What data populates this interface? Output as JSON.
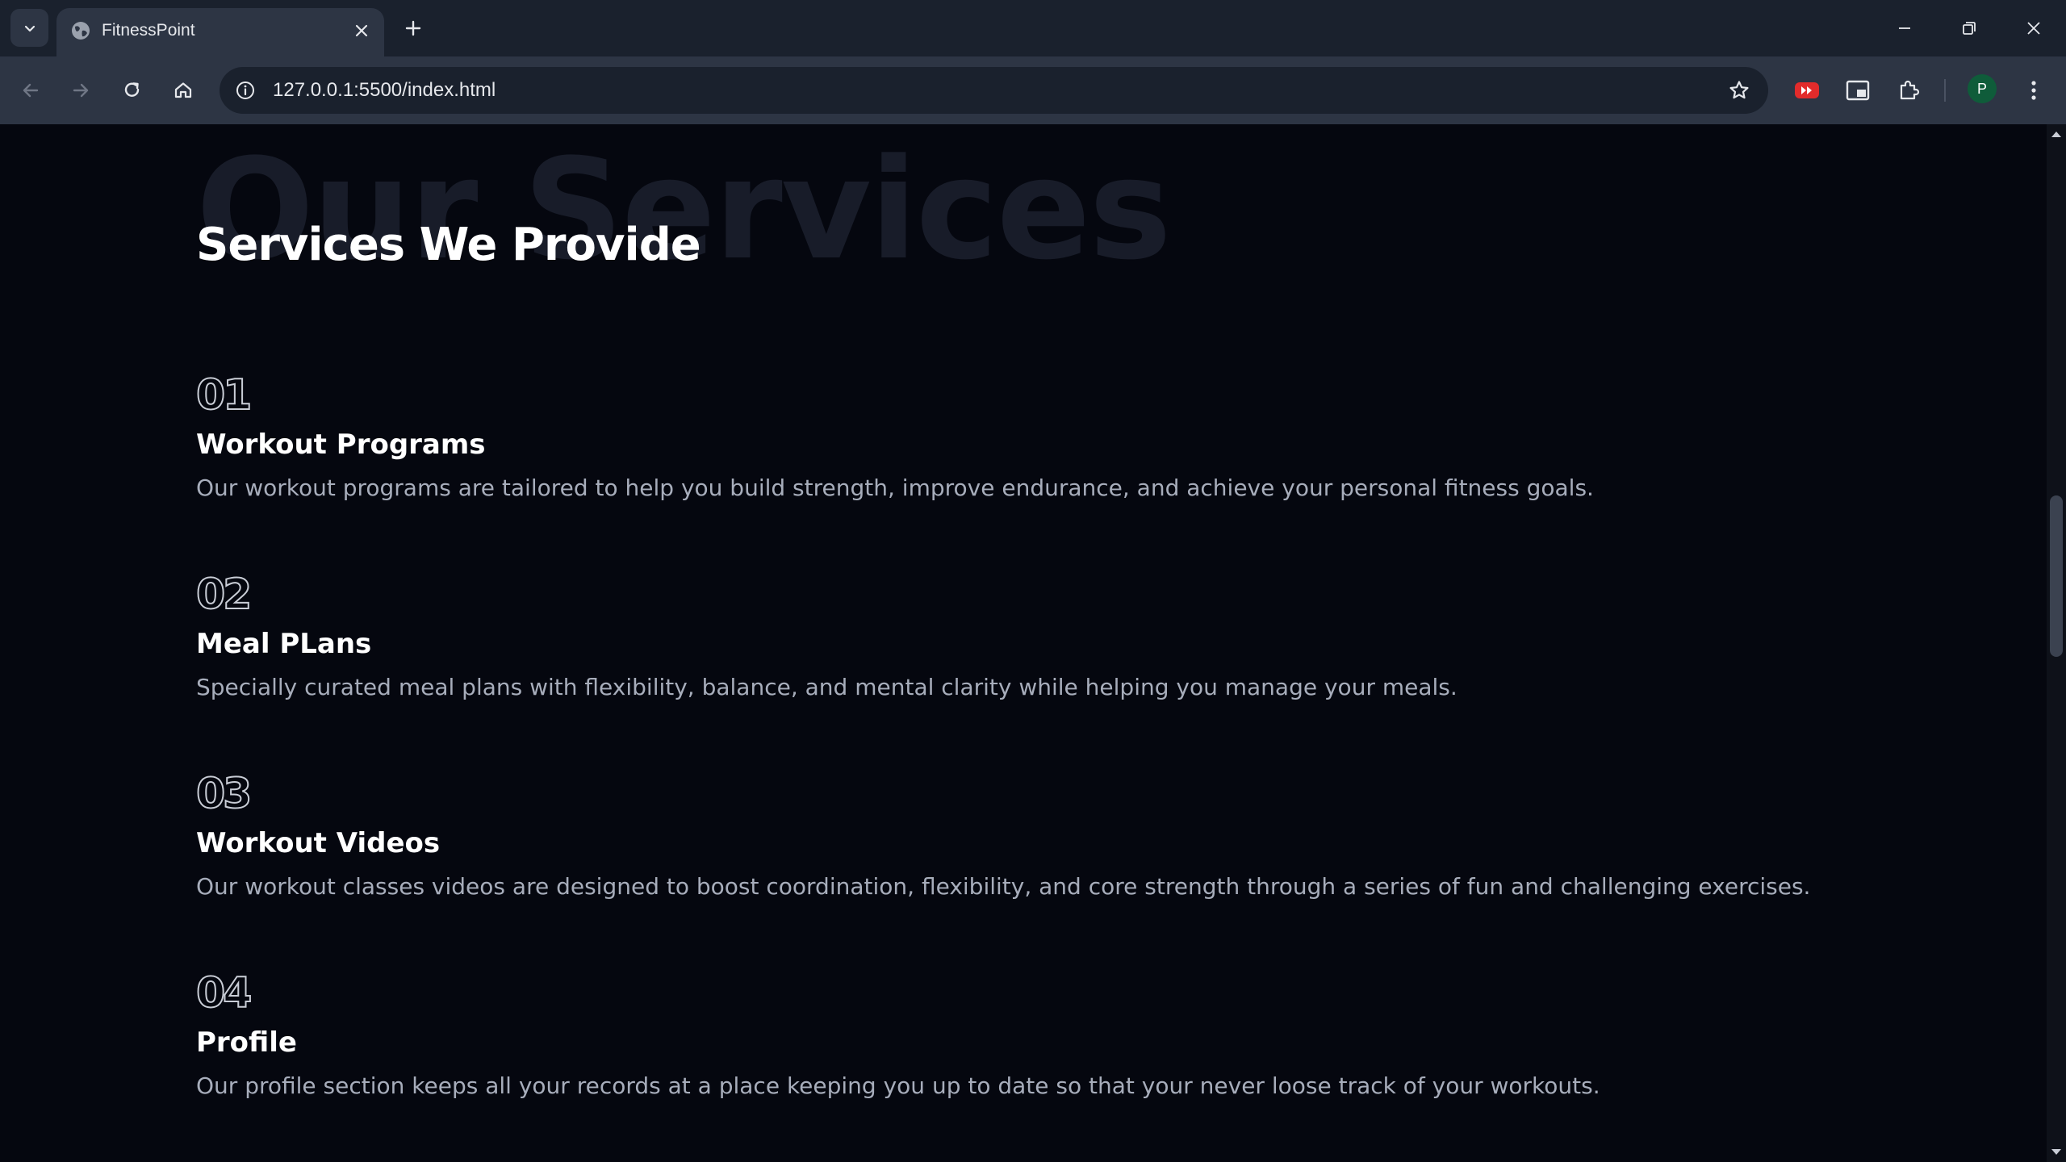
{
  "browser": {
    "tab": {
      "title": "FitnessPoint"
    },
    "omnibox": {
      "url": "127.0.0.1:5500/index.html"
    },
    "profile": {
      "initial": "P"
    }
  },
  "section": {
    "background_title": "Our Services",
    "title": "Services We Provide",
    "services": [
      {
        "number": "01",
        "title": "Workout Programs",
        "description": "Our workout programs are tailored to help you build strength, improve endurance, and achieve your personal fitness goals."
      },
      {
        "number": "02",
        "title": "Meal PLans",
        "description": "Specially curated meal plans with flexibility, balance, and mental clarity while helping you manage your meals."
      },
      {
        "number": "03",
        "title": "Workout Videos",
        "description": "Our workout classes videos are designed to boost coordination, flexibility, and core strength through a series of fun and challenging exercises."
      },
      {
        "number": "04",
        "title": "Profile",
        "description": "Our profile section keeps all your records at a place keeping you up to date so that your never loose track of your workouts."
      }
    ]
  },
  "scrollbar": {
    "position_fraction": 0.42
  }
}
